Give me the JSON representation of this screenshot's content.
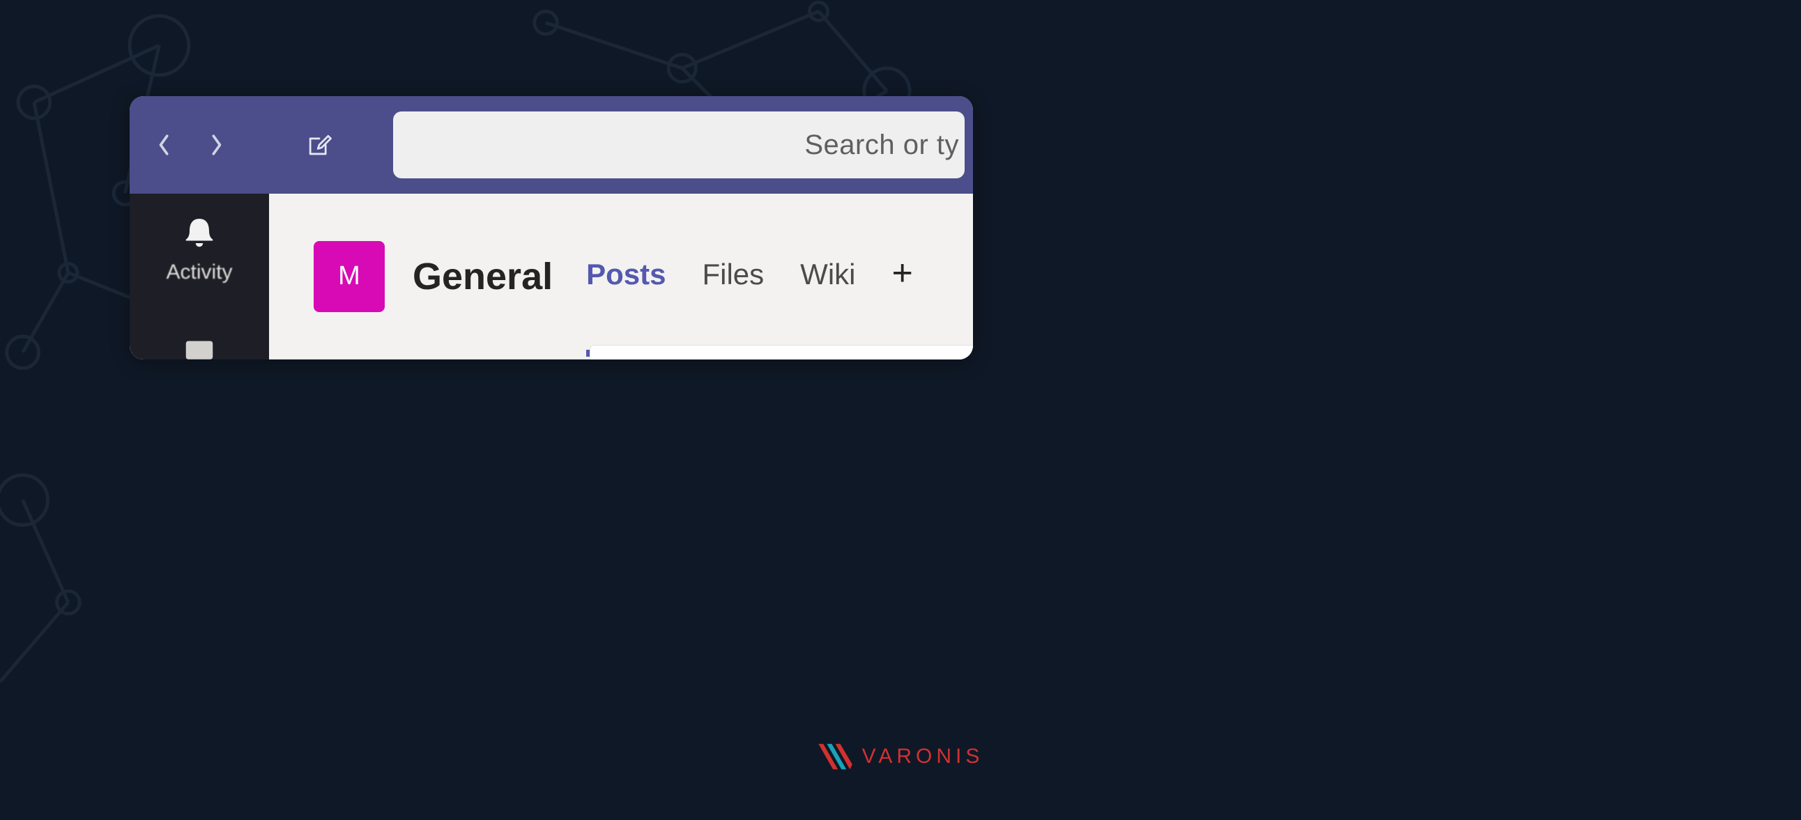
{
  "titlebar": {
    "search_placeholder": "Search or ty"
  },
  "left_rail": {
    "items": [
      {
        "label": "Activity",
        "icon": "bell"
      },
      {
        "label": "",
        "icon": "chat"
      }
    ]
  },
  "channel": {
    "avatar_letter": "M",
    "avatar_color": "#d80ab5",
    "name": "General",
    "tabs": [
      {
        "label": "Posts",
        "active": true
      },
      {
        "label": "Files",
        "active": false
      },
      {
        "label": "Wiki",
        "active": false
      }
    ]
  },
  "brand": {
    "name": "VARONIS"
  },
  "colors": {
    "titlebar": "#4b4e8a",
    "rail": "#1e1e27",
    "accent": "#5558af",
    "bg": "#0f1826"
  }
}
